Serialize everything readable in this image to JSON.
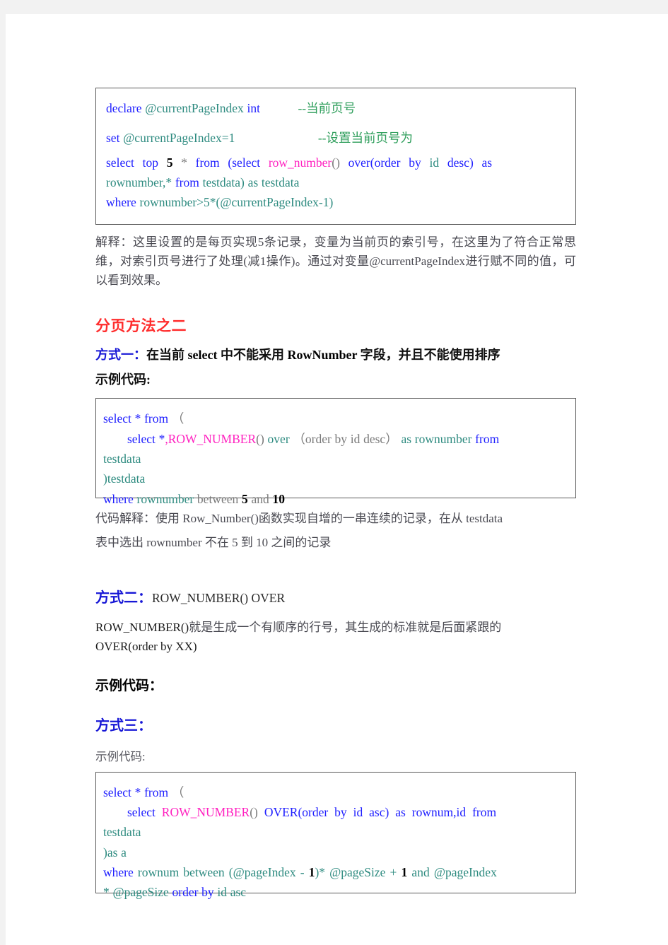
{
  "document": {
    "background_color": "#f2f2f2",
    "page_color": "#ffffff",
    "accent_red": "#ff2d2d",
    "accent_blue": "#1717d6",
    "keyword_color": "#2020ff",
    "variable_color": "#2e8b80",
    "function_color": "#ff22c0",
    "comment_color": "#2e9e5b"
  },
  "code_block_1": {
    "line1_kw": "declare",
    "line1_var": "@currentPageIndex",
    "line1_type": "int",
    "line1_comment": "--当前页号",
    "line2_kw": "set",
    "line2_expr": "@currentPageIndex=1",
    "line2_comment": "--设置当前页号为",
    "line3_a": "select",
    "line3_b": "top",
    "line3_num": "5",
    "line3_c": "*",
    "line3_d": "from",
    "line3_e": "(select",
    "line3_fn": "row_number",
    "line3_f": "()",
    "line3_g": "over(order",
    "line3_h": "by",
    "line3_i": "id",
    "line3_j": "desc)",
    "line3_k": "as",
    "line4_a": "rownumber,*",
    "line4_b": "from",
    "line4_c": "testdata) as testdata",
    "line5_kw": "where",
    "line5_rest": "rownumber>5*(@currentPageIndex-1)"
  },
  "explanation_1": "解释：这里设置的是每页实现5条记录，变量为当前页的索引号，在这里为了符合正常思维，对索引页号进行了处理(减1操作)。通过对变量@currentPageIndex进行赋不同的值，可以看到效果。",
  "heading_method_two": "分页方法之二",
  "way_one": {
    "label": "方式一",
    "colon": "：",
    "text_a": "在当前 ",
    "bold_select": "select",
    "text_b": " 中不能采用 ",
    "bold_rownumber": "RowNumber",
    "text_c": " 字段，并且不能使用排序",
    "sample_label": "示例代码:"
  },
  "code_block_2": {
    "line1_kw": "select",
    "line1_star": "*",
    "line1_from": "from",
    "line1_paren": "（",
    "line2_kw": "select",
    "line2_star": "*",
    "line2_comma": ",",
    "line2_fn": "ROW_NUMBER",
    "line2_parens": "()",
    "line2_over": "over",
    "line2_order": "（order by id desc）",
    "line2_as": "as",
    "line2_rownumber": "rownumber",
    "line2_from": "from",
    "line3_table": "testdata",
    "line4": ")testdata",
    "line5_kw": "where",
    "line5_col": "rownumber",
    "line5_between": "between",
    "line5_num1": "5",
    "line5_and": "and",
    "line5_num2": "10"
  },
  "explanation_2_line1": "代码解释：使用 Row_Number()函数实现自增的一串连续的记录，在从 testdata",
  "explanation_2_line2": "表中选出 rownumber 不在 5 到 10 之间的记录",
  "way_two": {
    "label": "方式二",
    "colon": "：",
    "title": "ROW_NUMBER()  OVER",
    "body_mono": "ROW_NUMBER()",
    "body_text": "就是生成一个有顺序的行号，其生成的标准就是后面紧跟的",
    "body_line2": "OVER(order by XX)",
    "sample_label": "示例代码："
  },
  "way_three": {
    "label": "方式三",
    "colon": "：",
    "sample_label": "示例代码:"
  },
  "code_block_3": {
    "line1_kw": "select",
    "line1_star": "*",
    "line1_from": "from",
    "line1_paren": "（",
    "line2_kw": "select",
    "line2_fn": "ROW_NUMBER",
    "line2_parens": "()",
    "line2_over": "OVER(order",
    "line2_by": "by",
    "line2_id": "id",
    "line2_asc": "asc)",
    "line2_as": "as",
    "line2_cols": "rownum,id",
    "line2_from": "from",
    "line3_table": "testdata",
    "line4": ")as a",
    "line5_kw": "where",
    "line5_col": "rownum",
    "line5_between": "between",
    "line5_open": "(",
    "line5_v1": "@pageIndex",
    "line5_minus": "- ",
    "line5_num1": "1",
    "line5_closestar": ")*",
    "line5_v2": "@pageSize",
    "line5_plus": "+",
    "line5_num2": "1",
    "line5_and": "and",
    "line5_v3": "@pageIndex",
    "line6_star": "*",
    "line6_v4": "@pageSize",
    "line6_order": "order by",
    "line6_idasc": "id asc"
  }
}
